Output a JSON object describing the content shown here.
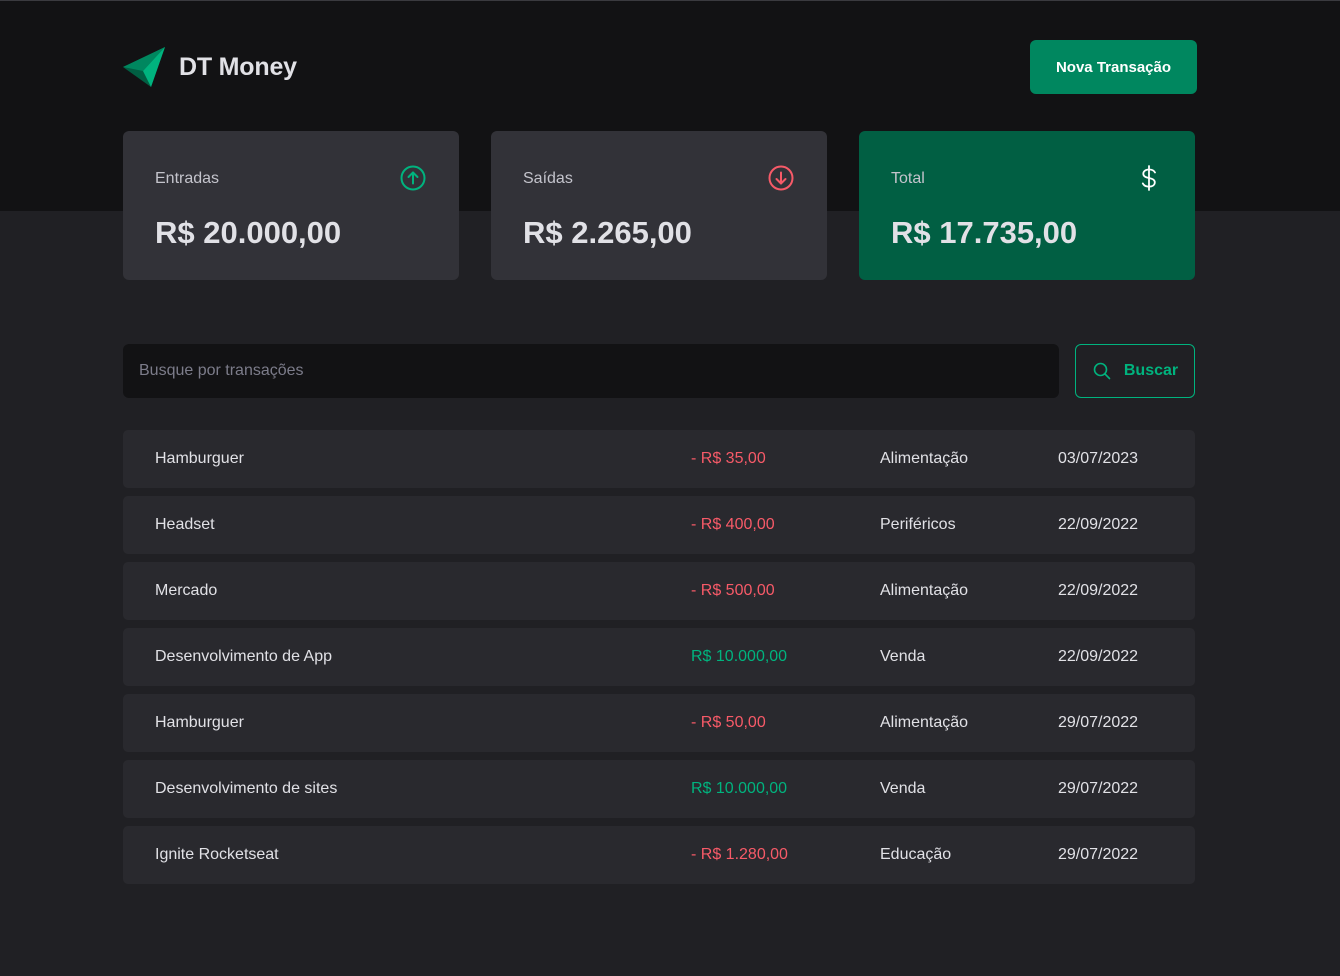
{
  "header": {
    "app_name": "DT Money",
    "new_transaction_label": "Nova Transação",
    "logo_icon": "dt-money-logo"
  },
  "summary": {
    "income": {
      "label": "Entradas",
      "value": "R$ 20.000,00",
      "icon": "arrow-circle-up-icon"
    },
    "outcome": {
      "label": "Saídas",
      "value": "R$ 2.265,00",
      "icon": "arrow-circle-down-icon"
    },
    "total": {
      "label": "Total",
      "value": "R$ 17.735,00",
      "icon": "currency-dollar-icon"
    }
  },
  "search": {
    "placeholder": "Busque por transações",
    "value": "",
    "button_label": "Buscar",
    "icon": "search-icon"
  },
  "transactions": [
    {
      "description": "Hamburguer",
      "price": "- R$ 35,00",
      "type": "outcome",
      "category": "Alimentação",
      "date": "03/07/2023"
    },
    {
      "description": "Headset",
      "price": "- R$ 400,00",
      "type": "outcome",
      "category": "Periféricos",
      "date": "22/09/2022"
    },
    {
      "description": "Mercado",
      "price": "- R$ 500,00",
      "type": "outcome",
      "category": "Alimentação",
      "date": "22/09/2022"
    },
    {
      "description": "Desenvolvimento de App",
      "price": "R$ 10.000,00",
      "type": "income",
      "category": "Venda",
      "date": "22/09/2022"
    },
    {
      "description": "Hamburguer",
      "price": "- R$ 50,00",
      "type": "outcome",
      "category": "Alimentação",
      "date": "29/07/2022"
    },
    {
      "description": "Desenvolvimento de sites",
      "price": "R$ 10.000,00",
      "type": "income",
      "category": "Venda",
      "date": "29/07/2022"
    },
    {
      "description": "Ignite Rocketseat",
      "price": "- R$ 1.280,00",
      "type": "outcome",
      "category": "Educação",
      "date": "29/07/2022"
    }
  ],
  "colors": {
    "brand": "#00875f",
    "brand_light": "#00b37e",
    "brand_dark": "#015f43",
    "outcome": "#f75a68",
    "background": "#202024",
    "header_background": "#121214"
  }
}
